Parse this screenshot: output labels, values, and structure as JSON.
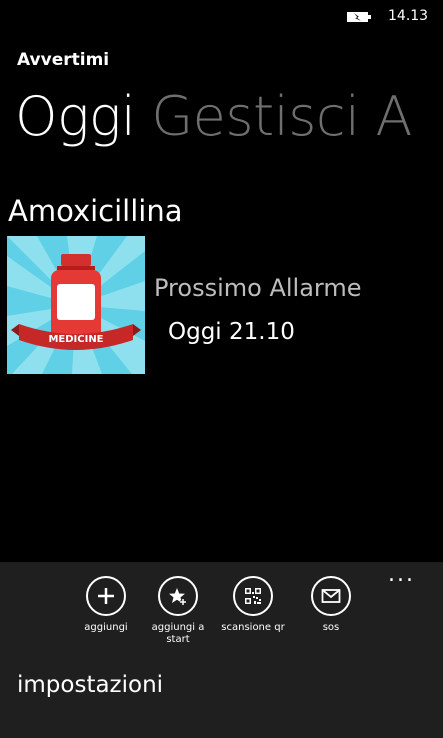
{
  "status_bar": {
    "time": "14.13",
    "battery_icon": "battery-charging-icon"
  },
  "app": {
    "title": "Avvertimi"
  },
  "pivot": {
    "tabs": [
      {
        "label": "Oggi",
        "active": true
      },
      {
        "label": "Gestisci",
        "active": false
      },
      {
        "label": "A",
        "active": false
      }
    ]
  },
  "medicine": {
    "name": "Amoxicillina",
    "image_icon": "medicine-bottle-icon",
    "image_banner": "MEDICINE",
    "next_alarm_label": "Prossimo Allarme",
    "next_alarm_value": "Oggi 21.10"
  },
  "app_bar": {
    "buttons": [
      {
        "label": "aggiungi",
        "icon": "plus-icon"
      },
      {
        "label": "aggiungi a start",
        "icon": "star-add-icon"
      },
      {
        "label": "scansione qr",
        "icon": "qr-code-icon"
      },
      {
        "label": "sos",
        "icon": "mail-icon"
      }
    ],
    "more_label": "...",
    "menu_items": [
      {
        "label": "impostazioni"
      }
    ]
  },
  "colors": {
    "background": "#000000",
    "app_bar_background": "#1f1f1f",
    "inactive_pivot": "#6f6f6f",
    "secondary_text": "#bdbdbd",
    "image_background": "#5fd0e6",
    "bottle_red": "#e53935"
  }
}
